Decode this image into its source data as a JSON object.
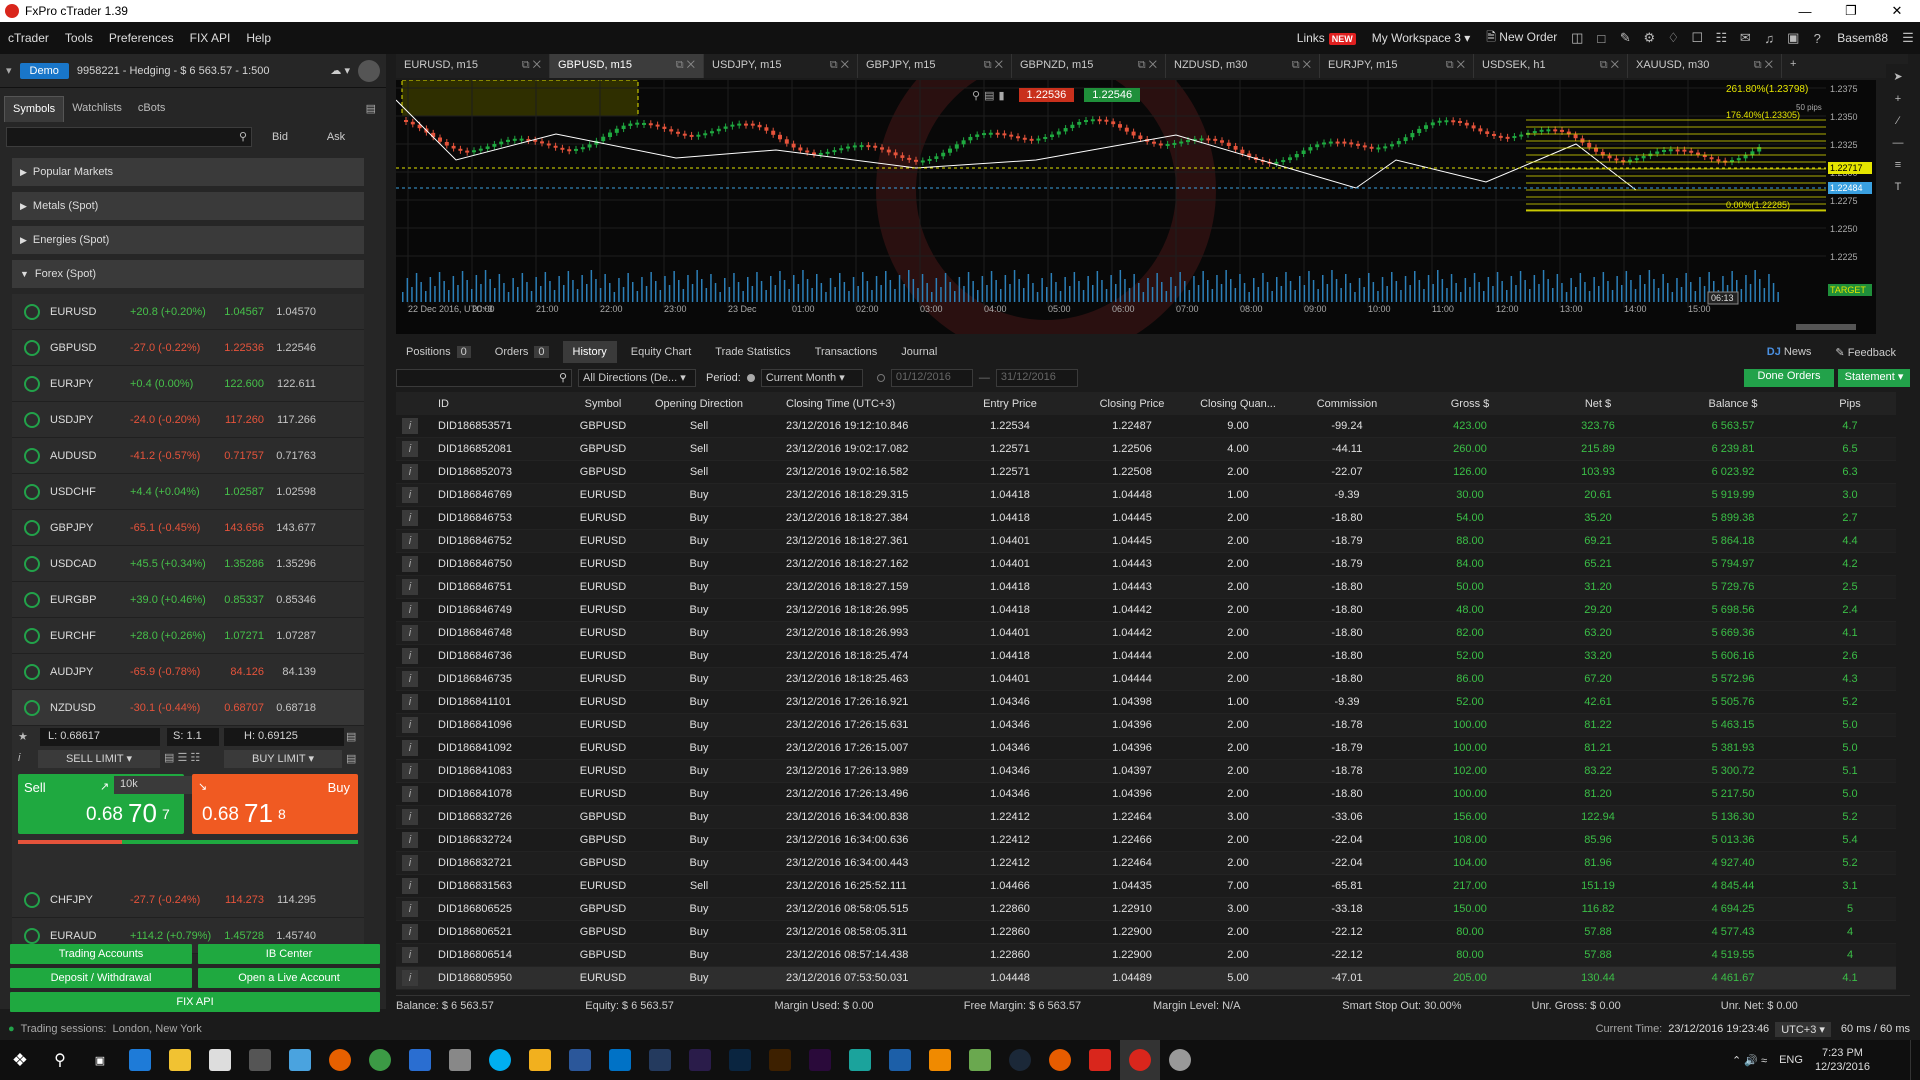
{
  "window": {
    "title": "FxPro cTrader 1.39"
  },
  "menu": {
    "items": [
      "cTrader",
      "Tools",
      "Preferences",
      "FIX API",
      "Help"
    ],
    "links": "Links",
    "new": "NEW",
    "workspace": "My Workspace 3",
    "new_order": "New Order",
    "user": "Basem88"
  },
  "account": {
    "mode": "Demo",
    "info": "9958221 - Hedging - $ 6 563.57 - 1:500"
  },
  "left_tabs": [
    "Symbols",
    "Watchlists",
    "cBots"
  ],
  "left_header": {
    "bid": "Bid",
    "ask": "Ask"
  },
  "categories": [
    "Popular Markets",
    "Metals (Spot)",
    "Energies (Spot)",
    "Forex (Spot)"
  ],
  "symbols": [
    {
      "name": "EURUSD",
      "change": "+20.8 (+0.20%)",
      "bid": "1.04567",
      "ask": "1.04570",
      "dir": "pos"
    },
    {
      "name": "GBPUSD",
      "change": "-27.0 (-0.22%)",
      "bid": "1.22536",
      "ask": "1.22546",
      "dir": "neg"
    },
    {
      "name": "EURJPY",
      "change": "+0.4 (0.00%)",
      "bid": "122.600",
      "ask": "122.611",
      "dir": "pos"
    },
    {
      "name": "USDJPY",
      "change": "-24.0 (-0.20%)",
      "bid": "117.260",
      "ask": "117.266",
      "dir": "neg"
    },
    {
      "name": "AUDUSD",
      "change": "-41.2 (-0.57%)",
      "bid": "0.71757",
      "ask": "0.71763",
      "dir": "neg"
    },
    {
      "name": "USDCHF",
      "change": "+4.4 (+0.04%)",
      "bid": "1.02587",
      "ask": "1.02598",
      "dir": "pos"
    },
    {
      "name": "GBPJPY",
      "change": "-65.1 (-0.45%)",
      "bid": "143.656",
      "ask": "143.677",
      "dir": "neg"
    },
    {
      "name": "USDCAD",
      "change": "+45.5 (+0.34%)",
      "bid": "1.35286",
      "ask": "1.35296",
      "dir": "pos"
    },
    {
      "name": "EURGBP",
      "change": "+39.0 (+0.46%)",
      "bid": "0.85337",
      "ask": "0.85346",
      "dir": "pos"
    },
    {
      "name": "EURCHF",
      "change": "+28.0 (+0.26%)",
      "bid": "1.07271",
      "ask": "1.07287",
      "dir": "pos"
    },
    {
      "name": "AUDJPY",
      "change": "-65.9 (-0.78%)",
      "bid": "84.126",
      "ask": "84.139",
      "dir": "neg"
    },
    {
      "name": "NZDUSD",
      "change": "-30.1 (-0.44%)",
      "bid": "0.68707",
      "ask": "0.68718",
      "dir": "neg"
    }
  ],
  "trade_panel": {
    "low": "L: 0.68617",
    "spread": "S: 1.1",
    "high": "H: 0.69125",
    "sell_limit": "SELL LIMIT",
    "buy_limit": "BUY LIMIT",
    "sell": "Sell",
    "buy": "Buy",
    "volume": "10k",
    "sell_price_a": "0.68",
    "sell_price_b": "70",
    "sell_price_c": "7",
    "buy_price_a": "0.68",
    "buy_price_b": "71",
    "buy_price_c": "8"
  },
  "symbols_after": [
    {
      "name": "CHFJPY",
      "change": "-27.7 (-0.24%)",
      "bid": "114.273",
      "ask": "114.295",
      "dir": "neg"
    },
    {
      "name": "EURAUD",
      "change": "+114.2 (+0.79%)",
      "bid": "1.45728",
      "ask": "1.45740",
      "dir": "pos"
    }
  ],
  "left_buttons": {
    "trading_accounts": "Trading Accounts",
    "ib_center": "IB Center",
    "deposit": "Deposit / Withdrawal",
    "open_live": "Open a Live Account",
    "fix_api": "FIX API"
  },
  "chart_tabs": [
    "EURUSD, m15",
    "GBPUSD, m15",
    "USDJPY, m15",
    "GBPJPY, m15",
    "GBPNZD, m15",
    "NZDUSD, m30",
    "EURJPY, m15",
    "USDSEK, h1",
    "XAUUSD, m30"
  ],
  "chart": {
    "sell_price": "1.22536",
    "buy_price": "1.22546",
    "bid_label": "1.22717",
    "ask_label": "1.22484",
    "target": "TARGET",
    "countdown": "06:13",
    "fib_top": "261.80%(1.23798)",
    "fib_a": "176.40%(1.23305)",
    "fib_b": "0.00%(1.22285)",
    "pips": "50 pips",
    "y_ticks": [
      "1.2375",
      "1.2350",
      "1.2325",
      "1.2300",
      "1.2275",
      "1.2250",
      "1.2225"
    ],
    "x_ticks": [
      "22 Dec 2016, UTC+3",
      "20:00",
      "21:00",
      "22:00",
      "23:00",
      "23 Dec",
      "01:00",
      "02:00",
      "03:00",
      "04:00",
      "05:00",
      "06:00",
      "07:00",
      "08:00",
      "09:00",
      "10:00",
      "11:00",
      "12:00",
      "13:00",
      "14:00",
      "15:00"
    ]
  },
  "bottom_tabs": [
    {
      "label": "Positions",
      "count": "0"
    },
    {
      "label": "Orders",
      "count": "0"
    },
    {
      "label": "History"
    },
    {
      "label": "Equity Chart"
    },
    {
      "label": "Trade Statistics"
    },
    {
      "label": "Transactions"
    },
    {
      "label": "Journal"
    }
  ],
  "bottom_right": {
    "news": "News",
    "feedback": "Feedback"
  },
  "filter": {
    "direction": "All Directions (De...",
    "period_label": "Period:",
    "period": "Current Month",
    "from": "01/12/2016",
    "to": "31/12/2016",
    "done_orders": "Done Orders",
    "statement": "Statement"
  },
  "columns": [
    "ID",
    "Symbol",
    "Opening Direction",
    "Closing Time (UTC+3)",
    "Entry Price",
    "Closing Price",
    "Closing Quan...",
    "Commission",
    "Gross $",
    "Net $",
    "Balance $",
    "Pips"
  ],
  "rows": [
    [
      "DID186853571",
      "GBPUSD",
      "Sell",
      "23/12/2016 19:12:10.846",
      "1.22534",
      "1.22487",
      "9.00",
      "-99.24",
      "423.00",
      "323.76",
      "6 563.57",
      "4.7"
    ],
    [
      "DID186852081",
      "GBPUSD",
      "Sell",
      "23/12/2016 19:02:17.082",
      "1.22571",
      "1.22506",
      "4.00",
      "-44.11",
      "260.00",
      "215.89",
      "6 239.81",
      "6.5"
    ],
    [
      "DID186852073",
      "GBPUSD",
      "Sell",
      "23/12/2016 19:02:16.582",
      "1.22571",
      "1.22508",
      "2.00",
      "-22.07",
      "126.00",
      "103.93",
      "6 023.92",
      "6.3"
    ],
    [
      "DID186846769",
      "EURUSD",
      "Buy",
      "23/12/2016 18:18:29.315",
      "1.04418",
      "1.04448",
      "1.00",
      "-9.39",
      "30.00",
      "20.61",
      "5 919.99",
      "3.0"
    ],
    [
      "DID186846753",
      "EURUSD",
      "Buy",
      "23/12/2016 18:18:27.384",
      "1.04418",
      "1.04445",
      "2.00",
      "-18.80",
      "54.00",
      "35.20",
      "5 899.38",
      "2.7"
    ],
    [
      "DID186846752",
      "EURUSD",
      "Buy",
      "23/12/2016 18:18:27.361",
      "1.04401",
      "1.04445",
      "2.00",
      "-18.79",
      "88.00",
      "69.21",
      "5 864.18",
      "4.4"
    ],
    [
      "DID186846750",
      "EURUSD",
      "Buy",
      "23/12/2016 18:18:27.162",
      "1.04401",
      "1.04443",
      "2.00",
      "-18.79",
      "84.00",
      "65.21",
      "5 794.97",
      "4.2"
    ],
    [
      "DID186846751",
      "EURUSD",
      "Buy",
      "23/12/2016 18:18:27.159",
      "1.04418",
      "1.04443",
      "2.00",
      "-18.80",
      "50.00",
      "31.20",
      "5 729.76",
      "2.5"
    ],
    [
      "DID186846749",
      "EURUSD",
      "Buy",
      "23/12/2016 18:18:26.995",
      "1.04418",
      "1.04442",
      "2.00",
      "-18.80",
      "48.00",
      "29.20",
      "5 698.56",
      "2.4"
    ],
    [
      "DID186846748",
      "EURUSD",
      "Buy",
      "23/12/2016 18:18:26.993",
      "1.04401",
      "1.04442",
      "2.00",
      "-18.80",
      "82.00",
      "63.20",
      "5 669.36",
      "4.1"
    ],
    [
      "DID186846736",
      "EURUSD",
      "Buy",
      "23/12/2016 18:18:25.474",
      "1.04418",
      "1.04444",
      "2.00",
      "-18.80",
      "52.00",
      "33.20",
      "5 606.16",
      "2.6"
    ],
    [
      "DID186846735",
      "EURUSD",
      "Buy",
      "23/12/2016 18:18:25.463",
      "1.04401",
      "1.04444",
      "2.00",
      "-18.80",
      "86.00",
      "67.20",
      "5 572.96",
      "4.3"
    ],
    [
      "DID186841101",
      "EURUSD",
      "Buy",
      "23/12/2016 17:26:16.921",
      "1.04346",
      "1.04398",
      "1.00",
      "-9.39",
      "52.00",
      "42.61",
      "5 505.76",
      "5.2"
    ],
    [
      "DID186841096",
      "EURUSD",
      "Buy",
      "23/12/2016 17:26:15.631",
      "1.04346",
      "1.04396",
      "2.00",
      "-18.78",
      "100.00",
      "81.22",
      "5 463.15",
      "5.0"
    ],
    [
      "DID186841092",
      "EURUSD",
      "Buy",
      "23/12/2016 17:26:15.007",
      "1.04346",
      "1.04396",
      "2.00",
      "-18.79",
      "100.00",
      "81.21",
      "5 381.93",
      "5.0"
    ],
    [
      "DID186841083",
      "EURUSD",
      "Buy",
      "23/12/2016 17:26:13.989",
      "1.04346",
      "1.04397",
      "2.00",
      "-18.78",
      "102.00",
      "83.22",
      "5 300.72",
      "5.1"
    ],
    [
      "DID186841078",
      "EURUSD",
      "Buy",
      "23/12/2016 17:26:13.496",
      "1.04346",
      "1.04396",
      "2.00",
      "-18.80",
      "100.00",
      "81.20",
      "5 217.50",
      "5.0"
    ],
    [
      "DID186832726",
      "GBPUSD",
      "Buy",
      "23/12/2016 16:34:00.838",
      "1.22412",
      "1.22464",
      "3.00",
      "-33.06",
      "156.00",
      "122.94",
      "5 136.30",
      "5.2"
    ],
    [
      "DID186832724",
      "GBPUSD",
      "Buy",
      "23/12/2016 16:34:00.636",
      "1.22412",
      "1.22466",
      "2.00",
      "-22.04",
      "108.00",
      "85.96",
      "5 013.36",
      "5.4"
    ],
    [
      "DID186832721",
      "GBPUSD",
      "Buy",
      "23/12/2016 16:34:00.443",
      "1.22412",
      "1.22464",
      "2.00",
      "-22.04",
      "104.00",
      "81.96",
      "4 927.40",
      "5.2"
    ],
    [
      "DID186831563",
      "EURUSD",
      "Sell",
      "23/12/2016 16:25:52.111",
      "1.04466",
      "1.04435",
      "7.00",
      "-65.81",
      "217.00",
      "151.19",
      "4 845.44",
      "3.1"
    ],
    [
      "DID186806525",
      "GBPUSD",
      "Buy",
      "23/12/2016 08:58:05.515",
      "1.22860",
      "1.22910",
      "3.00",
      "-33.18",
      "150.00",
      "116.82",
      "4 694.25",
      "5"
    ],
    [
      "DID186806521",
      "GBPUSD",
      "Buy",
      "23/12/2016 08:58:05.311",
      "1.22860",
      "1.22900",
      "2.00",
      "-22.12",
      "80.00",
      "57.88",
      "4 577.43",
      "4"
    ],
    [
      "DID186806514",
      "GBPUSD",
      "Buy",
      "23/12/2016 08:57:14.438",
      "1.22860",
      "1.22900",
      "2.00",
      "-22.12",
      "80.00",
      "57.88",
      "4 519.55",
      "4"
    ],
    [
      "DID186805950",
      "EURUSD",
      "Buy",
      "23/12/2016 07:53:50.031",
      "1.04448",
      "1.04489",
      "5.00",
      "-47.01",
      "205.00",
      "130.44",
      "4 461.67",
      "4.1"
    ]
  ],
  "status": {
    "balance": "Balance: $ 6 563.57",
    "equity": "Equity: $ 6 563.57",
    "margin_used": "Margin Used: $ 0.00",
    "free_margin": "Free Margin: $ 6 563.57",
    "margin_level": "Margin Level: N/A",
    "smart_stop": "Smart Stop Out: 30.00%",
    "unr_gross": "Unr. Gross: $ 0.00",
    "unr_net": "Unr. Net: $ 0.00"
  },
  "sessions": {
    "label": "Trading sessions:",
    "value": "London, New York",
    "current_time_label": "Current Time:",
    "current_time": "23/12/2016 19:23:46",
    "tz": "UTC+3",
    "latency": "60 ms / 60 ms"
  },
  "taskbar": {
    "time": "7:23 PM",
    "date": "12/23/2016",
    "lang": "ENG"
  }
}
